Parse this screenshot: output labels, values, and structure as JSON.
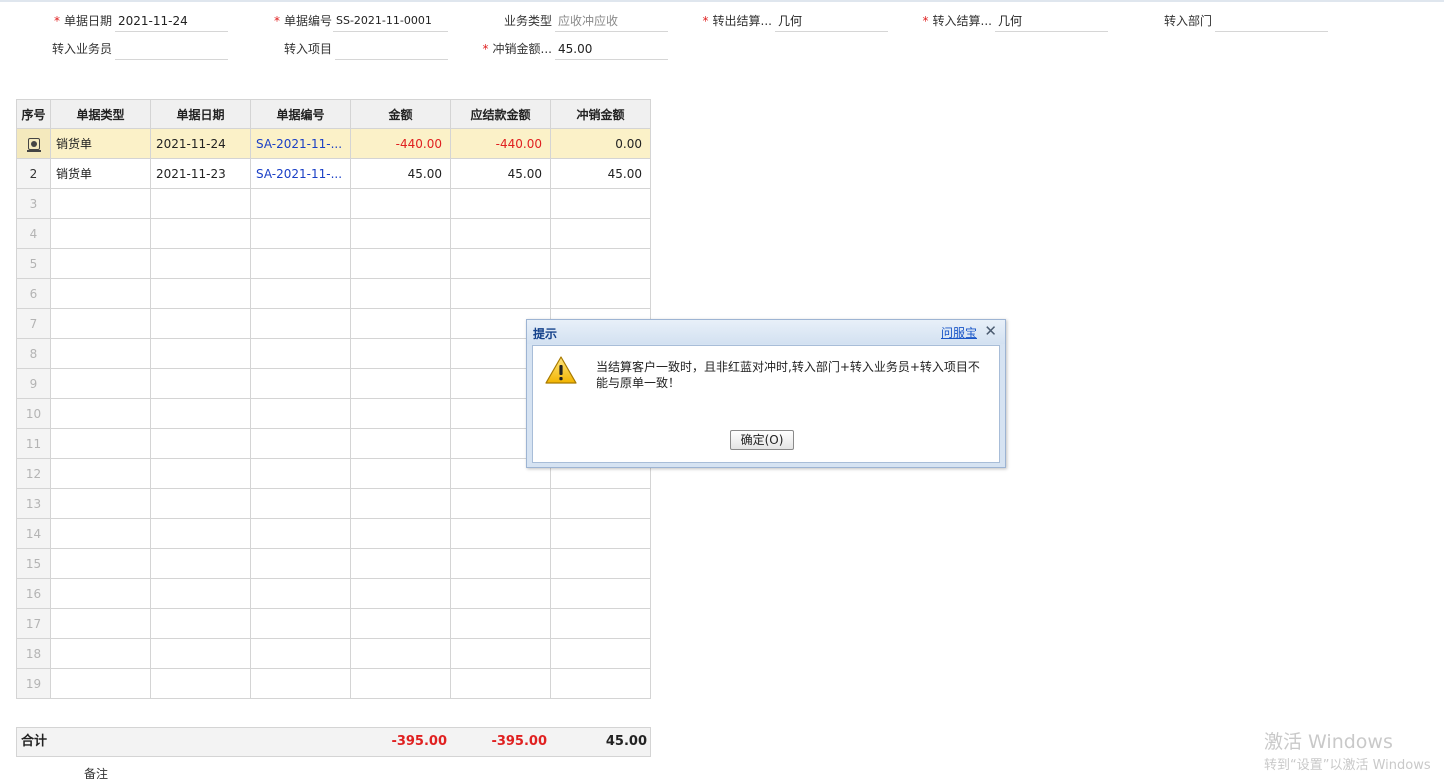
{
  "header_fields": {
    "doc_date": {
      "label": "单据日期",
      "value": "2021-11-24",
      "required": "*"
    },
    "doc_no": {
      "label": "单据编号",
      "value": "SS-2021-11-0001",
      "required": "*"
    },
    "biz_type": {
      "label": "业务类型",
      "value": "应收冲应收"
    },
    "out_customer": {
      "label": "转出结算...",
      "value": "几何",
      "required": "*"
    },
    "in_customer": {
      "label": "转入结算...",
      "value": "几何",
      "required": "*"
    },
    "in_dept": {
      "label": "转入部门",
      "value": ""
    },
    "in_salesman": {
      "label": "转入业务员",
      "value": ""
    },
    "in_project": {
      "label": "转入项目",
      "value": ""
    },
    "offset_amount": {
      "label": "冲销金额...",
      "value": "45.00",
      "required": "*"
    }
  },
  "grid": {
    "columns": [
      "序号",
      "单据类型",
      "单据日期",
      "单据编号",
      "金额",
      "应结款金额",
      "冲销金额"
    ],
    "rows": [
      {
        "seq": "",
        "type": "销货单",
        "date": "2021-11-24",
        "no": "SA-2021-11-...",
        "amount": "-440.00",
        "receivable": "-440.00",
        "offset": "0.00"
      },
      {
        "seq": "2",
        "type": "销货单",
        "date": "2021-11-23",
        "no": "SA-2021-11-...",
        "amount": "45.00",
        "receivable": "45.00",
        "offset": "45.00"
      }
    ],
    "empty_row_numbers": [
      "3",
      "4",
      "5",
      "6",
      "7",
      "8",
      "9",
      "10",
      "11",
      "12",
      "13",
      "14",
      "15",
      "16",
      "17",
      "18",
      "19"
    ]
  },
  "totals": {
    "label": "合计",
    "amount": "-395.00",
    "receivable": "-395.00",
    "offset": "45.00"
  },
  "remark_label": "备注",
  "dialog": {
    "title": "提示",
    "help_link": "问服宝",
    "close_glyph": "✕",
    "message": "当结算客户一致时，且非红蓝对冲时,转入部门+转入业务员+转入项目不能与原单一致！",
    "ok_button": "确定(O)"
  },
  "watermark": {
    "line1": "激活 Windows",
    "line2": "转到“设置”以激活 Windows"
  },
  "colors": {
    "negative": "#e02020",
    "link": "#1a3fc6",
    "selected_row": "#fbf1c8",
    "dialog_title": "#15428b"
  }
}
